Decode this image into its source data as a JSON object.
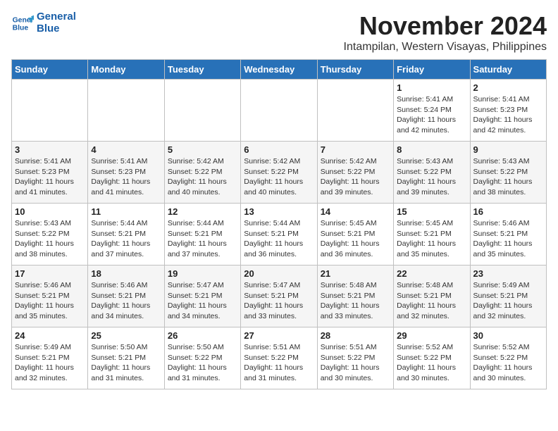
{
  "logo": {
    "line1": "General",
    "line2": "Blue"
  },
  "title": "November 2024",
  "location": "Intampilan, Western Visayas, Philippines",
  "days_of_week": [
    "Sunday",
    "Monday",
    "Tuesday",
    "Wednesday",
    "Thursday",
    "Friday",
    "Saturday"
  ],
  "weeks": [
    [
      {
        "day": "",
        "info": ""
      },
      {
        "day": "",
        "info": ""
      },
      {
        "day": "",
        "info": ""
      },
      {
        "day": "",
        "info": ""
      },
      {
        "day": "",
        "info": ""
      },
      {
        "day": "1",
        "info": "Sunrise: 5:41 AM\nSunset: 5:24 PM\nDaylight: 11 hours and 42 minutes."
      },
      {
        "day": "2",
        "info": "Sunrise: 5:41 AM\nSunset: 5:23 PM\nDaylight: 11 hours and 42 minutes."
      }
    ],
    [
      {
        "day": "3",
        "info": "Sunrise: 5:41 AM\nSunset: 5:23 PM\nDaylight: 11 hours and 41 minutes."
      },
      {
        "day": "4",
        "info": "Sunrise: 5:41 AM\nSunset: 5:23 PM\nDaylight: 11 hours and 41 minutes."
      },
      {
        "day": "5",
        "info": "Sunrise: 5:42 AM\nSunset: 5:22 PM\nDaylight: 11 hours and 40 minutes."
      },
      {
        "day": "6",
        "info": "Sunrise: 5:42 AM\nSunset: 5:22 PM\nDaylight: 11 hours and 40 minutes."
      },
      {
        "day": "7",
        "info": "Sunrise: 5:42 AM\nSunset: 5:22 PM\nDaylight: 11 hours and 39 minutes."
      },
      {
        "day": "8",
        "info": "Sunrise: 5:43 AM\nSunset: 5:22 PM\nDaylight: 11 hours and 39 minutes."
      },
      {
        "day": "9",
        "info": "Sunrise: 5:43 AM\nSunset: 5:22 PM\nDaylight: 11 hours and 38 minutes."
      }
    ],
    [
      {
        "day": "10",
        "info": "Sunrise: 5:43 AM\nSunset: 5:22 PM\nDaylight: 11 hours and 38 minutes."
      },
      {
        "day": "11",
        "info": "Sunrise: 5:44 AM\nSunset: 5:21 PM\nDaylight: 11 hours and 37 minutes."
      },
      {
        "day": "12",
        "info": "Sunrise: 5:44 AM\nSunset: 5:21 PM\nDaylight: 11 hours and 37 minutes."
      },
      {
        "day": "13",
        "info": "Sunrise: 5:44 AM\nSunset: 5:21 PM\nDaylight: 11 hours and 36 minutes."
      },
      {
        "day": "14",
        "info": "Sunrise: 5:45 AM\nSunset: 5:21 PM\nDaylight: 11 hours and 36 minutes."
      },
      {
        "day": "15",
        "info": "Sunrise: 5:45 AM\nSunset: 5:21 PM\nDaylight: 11 hours and 35 minutes."
      },
      {
        "day": "16",
        "info": "Sunrise: 5:46 AM\nSunset: 5:21 PM\nDaylight: 11 hours and 35 minutes."
      }
    ],
    [
      {
        "day": "17",
        "info": "Sunrise: 5:46 AM\nSunset: 5:21 PM\nDaylight: 11 hours and 35 minutes."
      },
      {
        "day": "18",
        "info": "Sunrise: 5:46 AM\nSunset: 5:21 PM\nDaylight: 11 hours and 34 minutes."
      },
      {
        "day": "19",
        "info": "Sunrise: 5:47 AM\nSunset: 5:21 PM\nDaylight: 11 hours and 34 minutes."
      },
      {
        "day": "20",
        "info": "Sunrise: 5:47 AM\nSunset: 5:21 PM\nDaylight: 11 hours and 33 minutes."
      },
      {
        "day": "21",
        "info": "Sunrise: 5:48 AM\nSunset: 5:21 PM\nDaylight: 11 hours and 33 minutes."
      },
      {
        "day": "22",
        "info": "Sunrise: 5:48 AM\nSunset: 5:21 PM\nDaylight: 11 hours and 32 minutes."
      },
      {
        "day": "23",
        "info": "Sunrise: 5:49 AM\nSunset: 5:21 PM\nDaylight: 11 hours and 32 minutes."
      }
    ],
    [
      {
        "day": "24",
        "info": "Sunrise: 5:49 AM\nSunset: 5:21 PM\nDaylight: 11 hours and 32 minutes."
      },
      {
        "day": "25",
        "info": "Sunrise: 5:50 AM\nSunset: 5:21 PM\nDaylight: 11 hours and 31 minutes."
      },
      {
        "day": "26",
        "info": "Sunrise: 5:50 AM\nSunset: 5:22 PM\nDaylight: 11 hours and 31 minutes."
      },
      {
        "day": "27",
        "info": "Sunrise: 5:51 AM\nSunset: 5:22 PM\nDaylight: 11 hours and 31 minutes."
      },
      {
        "day": "28",
        "info": "Sunrise: 5:51 AM\nSunset: 5:22 PM\nDaylight: 11 hours and 30 minutes."
      },
      {
        "day": "29",
        "info": "Sunrise: 5:52 AM\nSunset: 5:22 PM\nDaylight: 11 hours and 30 minutes."
      },
      {
        "day": "30",
        "info": "Sunrise: 5:52 AM\nSunset: 5:22 PM\nDaylight: 11 hours and 30 minutes."
      }
    ]
  ]
}
